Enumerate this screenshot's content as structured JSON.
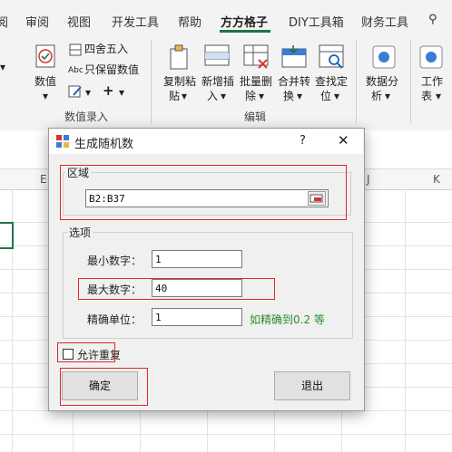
{
  "ribbon_tabs": [
    "阅",
    "审阅",
    "视图",
    "开发工具",
    "帮助",
    "方方格子",
    "DIY工具箱",
    "财务工具"
  ],
  "ribbon": {
    "numeric_btn": "数值",
    "round_label": "四舍五入",
    "keep_num_label": "只保留数值",
    "group_num_entry": "数值录入",
    "copy_paste_1": "复制粘",
    "copy_paste_2": "贴",
    "batch_insert_1": "新增插",
    "batch_insert_2": "入",
    "batch_delete_1": "批量删",
    "batch_delete_2": "除",
    "merge_1": "合并转",
    "merge_2": "换",
    "find_1": "查找定",
    "find_2": "位",
    "group_edit": "编辑",
    "data_analysis_1": "数据分",
    "data_analysis_2": "析",
    "worksheet_1": "工作",
    "worksheet_2": "表"
  },
  "sheet": {
    "columns_visible": [
      "E",
      "J",
      "K"
    ]
  },
  "dialog": {
    "title": "生成随机数",
    "help": "?",
    "close": "✕",
    "area_legend": "区域",
    "area_value": "B2:B37",
    "options_legend": "选项",
    "min_label": "最小数字：",
    "min_value": "1",
    "max_label": "最大数字：",
    "max_value": "40",
    "precision_label": "精确单位：",
    "precision_value": "1",
    "precision_hint": "如精确到0.2 等",
    "allow_repeat": "允许重复",
    "ok": "确定",
    "exit": "退出"
  },
  "colors": {
    "accent": "#217346",
    "hint": "#2e8b2e",
    "highlight": "#e0262b"
  }
}
